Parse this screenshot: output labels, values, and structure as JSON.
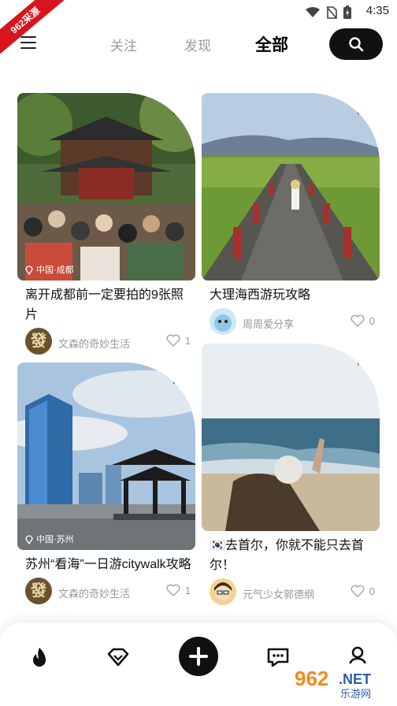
{
  "status_bar": {
    "time": "4:35",
    "ribbon": "962采源"
  },
  "nav": {
    "tabs": [
      {
        "label": "关注",
        "active": false
      },
      {
        "label": "发现",
        "active": false
      },
      {
        "label": "全部",
        "active": true
      }
    ]
  },
  "posts": [
    {
      "title": "离开成都前一定要拍的9张照片",
      "location": "中国·成都",
      "author": "文森的奇妙生活",
      "likes": "1",
      "avatar_text": "發"
    },
    {
      "title": "大理海西游玩攻略",
      "location": "",
      "author": "周周爱分享",
      "likes": "0"
    },
    {
      "title": "苏州“看海”一日游citywalk攻略",
      "location": "中国·苏州",
      "author": "文森的奇妙生活",
      "likes": "1",
      "avatar_text": "發"
    },
    {
      "title": "🇰🇷去首尔，你就不能只去首尔！",
      "location": "",
      "author": "元气少女郭德纲",
      "likes": "0"
    }
  ],
  "watermark": {
    "brand": "962",
    "suffix": ".NET",
    "sub": "乐游网"
  },
  "colors": {
    "accent": "#111111",
    "tab_highlight": "#bfe9ff",
    "ribbon": "#d8141c"
  }
}
